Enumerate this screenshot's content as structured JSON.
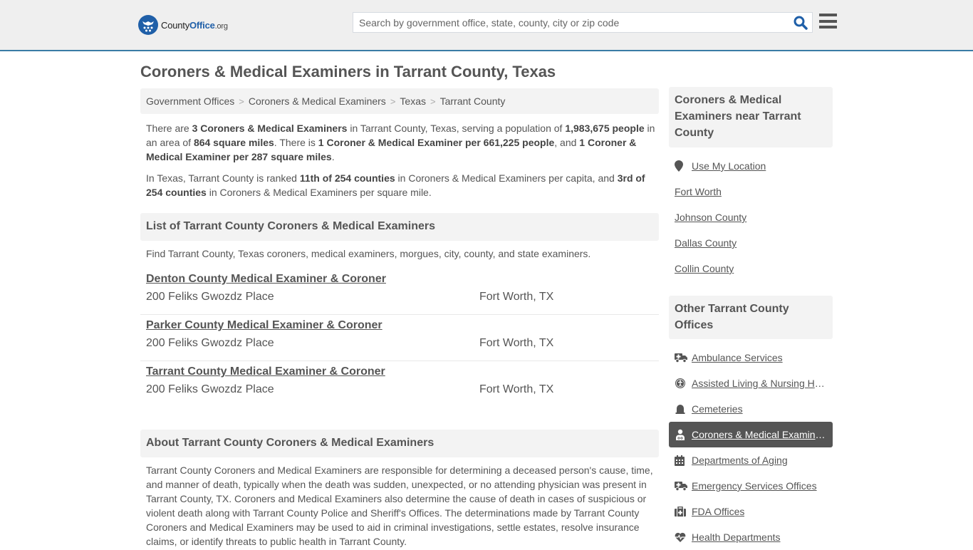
{
  "header": {
    "logo": {
      "county": "County",
      "office": "Office",
      "tld": ".org",
      "icon": "eagle-stars-badge-icon"
    },
    "search": {
      "placeholder": "Search by government office, state, county, city or zip code",
      "value": "",
      "icon": "search-icon"
    },
    "menu_icon": "hamburger-menu-icon"
  },
  "colors": {
    "brand_blue": "#1f5fa8",
    "header_border": "#3a7ca5",
    "text": "#555555",
    "panel_bg": "#f3f3f3",
    "active_bg": "#555555"
  },
  "page_title": "Coroners & Medical Examiners in Tarrant County, Texas",
  "breadcrumb": {
    "items": [
      "Government Offices",
      "Coroners & Medical Examiners",
      "Texas",
      "Tarrant County"
    ],
    "separator": ">"
  },
  "intro": {
    "p1": {
      "t1": "There are ",
      "b1": "3 Coroners & Medical Examiners",
      "t2": " in Tarrant County, Texas, serving a population of ",
      "b2": "1,983,675 people",
      "t3": " in an area of ",
      "b3": "864 square miles",
      "t4": ". There is ",
      "b4": "1 Coroner & Medical Examiner per 661,225 people",
      "t5": ", and ",
      "b5": "1 Coroner & Medical Examiner per 287 square miles",
      "t6": "."
    },
    "p2": {
      "t1": "In Texas, Tarrant County is ranked ",
      "b1": "11th of 254 counties",
      "t2": " in Coroners & Medical Examiners per capita, and ",
      "b2": "3rd of 254 counties",
      "t3": " in Coroners & Medical Examiners per square mile."
    }
  },
  "list_section": {
    "heading": "List of Tarrant County Coroners & Medical Examiners",
    "description": "Find Tarrant County, Texas coroners, medical examiners, morgues, city, county, and state examiners.",
    "listings": [
      {
        "name": "Denton County Medical Examiner & Coroner",
        "address": "200 Feliks Gwozdz Place",
        "city": "Fort Worth, TX"
      },
      {
        "name": "Parker County Medical Examiner & Coroner",
        "address": "200 Feliks Gwozdz Place",
        "city": "Fort Worth, TX"
      },
      {
        "name": "Tarrant County Medical Examiner & Coroner",
        "address": "200 Feliks Gwozdz Place",
        "city": "Fort Worth, TX"
      }
    ]
  },
  "about_section": {
    "heading": "About Tarrant County Coroners & Medical Examiners",
    "body": "Tarrant County Coroners and Medical Examiners are responsible for determining a deceased person's cause, time, and manner of death, typically when the death was sudden, unexpected, or no attending physician was present in Tarrant County, TX. Coroners and Medical Examiners also determine the cause of death in cases of suspicious or violent death along with Tarrant County Police and Sheriff's Offices. The determinations made by Tarrant County Coroners and Medical Examiners may be used to aid in criminal investigations, settle estates, resolve insurance claims, or identify threats to public health in Tarrant County."
  },
  "sidebar": {
    "nearby": {
      "heading": "Coroners & Medical Examiners near Tarrant County",
      "use_location": {
        "label": "Use My Location",
        "icon": "map-marker-icon"
      },
      "links": [
        "Fort Worth",
        "Johnson County",
        "Dallas County",
        "Collin County"
      ]
    },
    "other": {
      "heading": "Other Tarrant County Offices",
      "items": [
        {
          "label": "Ambulance Services",
          "icon": "ambulance-icon",
          "active": false
        },
        {
          "label": "Assisted Living & Nursing Homes",
          "icon": "accessibility-icon",
          "active": false
        },
        {
          "label": "Cemeteries",
          "icon": "tombstone-icon",
          "active": false
        },
        {
          "label": "Coroners & Medical Examiners",
          "icon": "doctor-icon",
          "active": true
        },
        {
          "label": "Departments of Aging",
          "icon": "calendar-icon",
          "active": false
        },
        {
          "label": "Emergency Services Offices",
          "icon": "ambulance-icon",
          "active": false
        },
        {
          "label": "FDA Offices",
          "icon": "medical-kit-icon",
          "active": false
        },
        {
          "label": "Health Departments",
          "icon": "heartbeat-icon",
          "active": false
        }
      ]
    }
  }
}
